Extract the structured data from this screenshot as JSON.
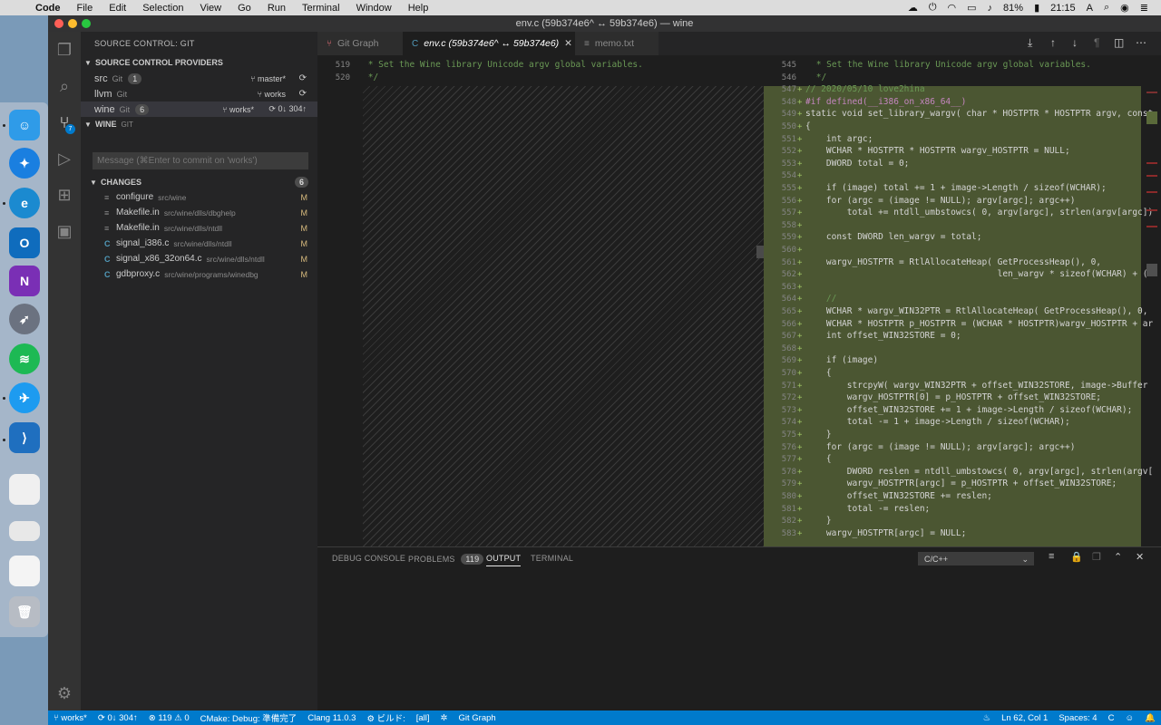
{
  "menubar": {
    "app": "Code",
    "items": [
      "File",
      "Edit",
      "Selection",
      "View",
      "Go",
      "Run",
      "Terminal",
      "Window",
      "Help"
    ],
    "battery": "81%",
    "time": "21:15",
    "input": "A"
  },
  "window": {
    "title": "env.c (59b374e6^ ↔ 59b374e6) — wine"
  },
  "sidebar": {
    "title": "SOURCE CONTROL: GIT",
    "providers_header": "SOURCE CONTROL PROVIDERS",
    "providers": [
      {
        "name": "src",
        "sub": "Git",
        "badge": "1",
        "branch": "master*",
        "sync": "⟳"
      },
      {
        "name": "llvm",
        "sub": "Git",
        "badge": "",
        "branch": "works",
        "sync": "⟳"
      },
      {
        "name": "wine",
        "sub": "Git",
        "badge": "6",
        "branch": "works*",
        "sync": "⟳ 0↓ 304↑"
      }
    ],
    "repo_header": "WINE",
    "repo_sub": "GIT",
    "commit_placeholder": "Message (⌘Enter to commit on 'works')",
    "changes_header": "CHANGES",
    "changes_count": "6",
    "changes": [
      {
        "icon": "≡",
        "name": "configure",
        "path": "src/wine",
        "status": "M"
      },
      {
        "icon": "≡",
        "name": "Makefile.in",
        "path": "src/wine/dlls/dbghelp",
        "status": "M"
      },
      {
        "icon": "≡",
        "name": "Makefile.in",
        "path": "src/wine/dlls/ntdll",
        "status": "M"
      },
      {
        "icon": "C",
        "name": "signal_i386.c",
        "path": "src/wine/dlls/ntdll",
        "status": "M"
      },
      {
        "icon": "C",
        "name": "signal_x86_32on64.c",
        "path": "src/wine/dlls/ntdll",
        "status": "M"
      },
      {
        "icon": "C",
        "name": "gdbproxy.c",
        "path": "src/wine/programs/winedbg",
        "status": "M"
      }
    ]
  },
  "tabs": [
    {
      "label": "Git Graph",
      "icon": "⑂"
    },
    {
      "label": "env.c (59b374e6^ ↔ 59b374e6)",
      "icon": "C"
    },
    {
      "label": "memo.txt",
      "icon": "≡"
    }
  ],
  "editor": {
    "left": {
      "lines": [
        {
          "n": "519",
          "text": " * Set the Wine library Unicode argv global variables."
        },
        {
          "n": "520",
          "text": " */"
        }
      ]
    },
    "right": {
      "lines": [
        {
          "n": "545",
          "text": " * Set the Wine library Unicode argv global variables."
        },
        {
          "n": "546",
          "text": " */"
        },
        {
          "n": "547",
          "text": "// 2020/05/10 love2hina"
        },
        {
          "n": "548",
          "text": "#if defined(__i386_on_x86_64__)"
        },
        {
          "n": "549",
          "text": "static void set_library_wargv( char * HOSTPTR * HOSTPTR argv, const"
        },
        {
          "n": "550",
          "text": "{"
        },
        {
          "n": "551",
          "text": "    int argc;"
        },
        {
          "n": "552",
          "text": "    WCHAR * HOSTPTR * HOSTPTR wargv_HOSTPTR = NULL;"
        },
        {
          "n": "553",
          "text": "    DWORD total = 0;"
        },
        {
          "n": "554",
          "text": ""
        },
        {
          "n": "555",
          "text": "    if (image) total += 1 + image->Length / sizeof(WCHAR);"
        },
        {
          "n": "556",
          "text": "    for (argc = (image != NULL); argv[argc]; argc++)"
        },
        {
          "n": "557",
          "text": "        total += ntdll_umbstowcs( 0, argv[argc], strlen(argv[argc])"
        },
        {
          "n": "558",
          "text": ""
        },
        {
          "n": "559",
          "text": "    const DWORD len_wargv = total;"
        },
        {
          "n": "560",
          "text": ""
        },
        {
          "n": "561",
          "text": "    wargv_HOSTPTR = RtlAllocateHeap( GetProcessHeap(), 0,"
        },
        {
          "n": "562",
          "text": "                                     len_wargv * sizeof(WCHAR) + (a"
        },
        {
          "n": "563",
          "text": ""
        },
        {
          "n": "564",
          "text": "    //"
        },
        {
          "n": "565",
          "text": "    WCHAR * wargv_WIN32PTR = RtlAllocateHeap( GetProcessHeap(), 0,"
        },
        {
          "n": "566",
          "text": "    WCHAR * HOSTPTR p_HOSTPTR = (WCHAR * HOSTPTR)wargv_HOSTPTR + ar"
        },
        {
          "n": "567",
          "text": "    int offset_WIN32STORE = 0;"
        },
        {
          "n": "568",
          "text": ""
        },
        {
          "n": "569",
          "text": "    if (image)"
        },
        {
          "n": "570",
          "text": "    {"
        },
        {
          "n": "571",
          "text": "        strcpyW( wargv_WIN32PTR + offset_WIN32STORE, image->Buffer"
        },
        {
          "n": "572",
          "text": "        wargv_HOSTPTR[0] = p_HOSTPTR + offset_WIN32STORE;"
        },
        {
          "n": "573",
          "text": "        offset_WIN32STORE += 1 + image->Length / sizeof(WCHAR);"
        },
        {
          "n": "574",
          "text": "        total -= 1 + image->Length / sizeof(WCHAR);"
        },
        {
          "n": "575",
          "text": "    }"
        },
        {
          "n": "576",
          "text": "    for (argc = (image != NULL); argv[argc]; argc++)"
        },
        {
          "n": "577",
          "text": "    {"
        },
        {
          "n": "578",
          "text": "        DWORD reslen = ntdll_umbstowcs( 0, argv[argc], strlen(argv["
        },
        {
          "n": "579",
          "text": "        wargv_HOSTPTR[argc] = p_HOSTPTR + offset_WIN32STORE;"
        },
        {
          "n": "580",
          "text": "        offset_WIN32STORE += reslen;"
        },
        {
          "n": "581",
          "text": "        total -= reslen;"
        },
        {
          "n": "582",
          "text": "    }"
        },
        {
          "n": "583",
          "text": "    wargv_HOSTPTR[argc] = NULL;"
        }
      ]
    }
  },
  "panel": {
    "tabs": [
      "DEBUG CONSOLE",
      "PROBLEMS",
      "OUTPUT",
      "TERMINAL"
    ],
    "problems_badge": "119",
    "output_channel": "C/C++"
  },
  "statusbar": {
    "branch": "works*",
    "sync": "0↓ 304↑",
    "errors": "119",
    "warnings": "0",
    "cmake": "CMake: Debug: 準備完了",
    "clang": "Clang 11.0.3",
    "build": "ビルド:",
    "target": "[all]",
    "gitgraph": "Git Graph",
    "position": "Ln 62, Col 1",
    "spaces": "Spaces: 4",
    "lang": "C"
  },
  "colors": {
    "accent": "#007acc",
    "added_bg": "#4b5632",
    "modified": "#d7ba7d"
  }
}
